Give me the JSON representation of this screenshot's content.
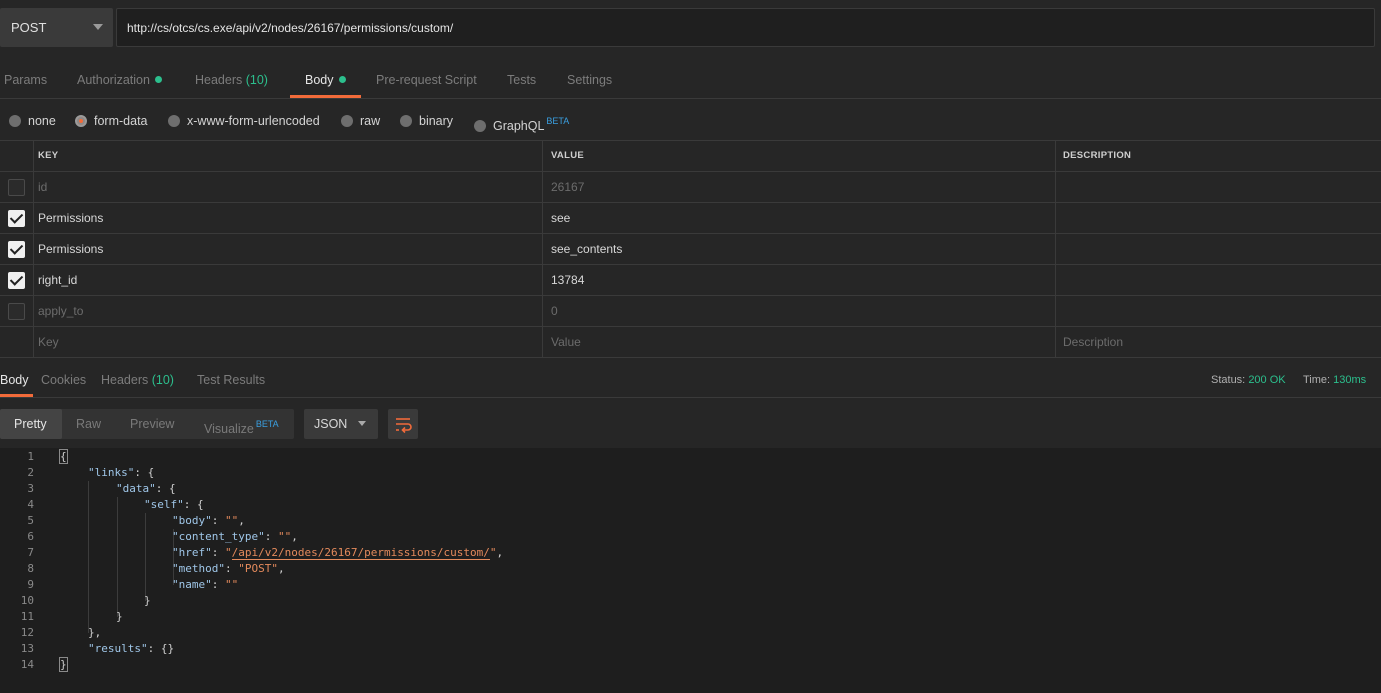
{
  "request": {
    "method": "POST",
    "url": "http://cs/otcs/cs.exe/api/v2/nodes/26167/permissions/custom/"
  },
  "request_tabs": [
    {
      "label": "Params",
      "count": "",
      "dot": false,
      "active": false
    },
    {
      "label": "Authorization",
      "count": "",
      "dot": true,
      "active": false
    },
    {
      "label": "Headers",
      "count": "(10)",
      "dot": false,
      "active": false
    },
    {
      "label": "Body",
      "count": "",
      "dot": true,
      "active": true
    },
    {
      "label": "Pre-request Script",
      "count": "",
      "dot": false,
      "active": false
    },
    {
      "label": "Tests",
      "count": "",
      "dot": false,
      "active": false
    },
    {
      "label": "Settings",
      "count": "",
      "dot": false,
      "active": false
    }
  ],
  "body_types": [
    {
      "label": "none",
      "selected": false
    },
    {
      "label": "form-data",
      "selected": true
    },
    {
      "label": "x-www-form-urlencoded",
      "selected": false
    },
    {
      "label": "raw",
      "selected": false
    },
    {
      "label": "binary",
      "selected": false
    },
    {
      "label": "GraphQL",
      "selected": false,
      "badge": "BETA"
    }
  ],
  "form_table": {
    "headers": {
      "key": "KEY",
      "value": "VALUE",
      "description": "DESCRIPTION"
    },
    "rows": [
      {
        "checked": false,
        "key": "id",
        "value": "26167",
        "description": ""
      },
      {
        "checked": true,
        "key": "Permissions",
        "value": "see",
        "description": ""
      },
      {
        "checked": true,
        "key": "Permissions",
        "value": "see_contents",
        "description": ""
      },
      {
        "checked": true,
        "key": "right_id",
        "value": "13784",
        "description": ""
      },
      {
        "checked": false,
        "key": "apply_to",
        "value": "0",
        "description": ""
      }
    ],
    "placeholder": {
      "key": "Key",
      "value": "Value",
      "description": "Description"
    }
  },
  "response_tabs": [
    {
      "label": "Body",
      "count": "",
      "active": true
    },
    {
      "label": "Cookies",
      "count": "",
      "active": false
    },
    {
      "label": "Headers",
      "count": "(10)",
      "active": false
    },
    {
      "label": "Test Results",
      "count": "",
      "active": false
    }
  ],
  "status": {
    "status_label": "Status:",
    "status_value": "200 OK",
    "time_label": "Time:",
    "time_value": "130ms"
  },
  "view_modes": [
    {
      "label": "Pretty",
      "active": true
    },
    {
      "label": "Raw",
      "active": false
    },
    {
      "label": "Preview",
      "active": false
    },
    {
      "label": "Visualize",
      "active": false,
      "badge": "BETA"
    }
  ],
  "format": "JSON",
  "wrap_icon": "wrap-lines-icon",
  "colors": {
    "accent": "#f26b3a",
    "success": "#2cbf8d",
    "beta": "#3a9fe0"
  },
  "code_lines": [
    {
      "n": "1",
      "indent": 0,
      "parts": [
        [
          "p",
          "{"
        ]
      ]
    },
    {
      "n": "2",
      "indent": 1,
      "parts": [
        [
          "k",
          "\"links\""
        ],
        [
          "p",
          ": {"
        ]
      ]
    },
    {
      "n": "3",
      "indent": 2,
      "parts": [
        [
          "k",
          "\"data\""
        ],
        [
          "p",
          ": {"
        ]
      ]
    },
    {
      "n": "4",
      "indent": 3,
      "parts": [
        [
          "k",
          "\"self\""
        ],
        [
          "p",
          ": {"
        ]
      ]
    },
    {
      "n": "5",
      "indent": 4,
      "parts": [
        [
          "k",
          "\"body\""
        ],
        [
          "p",
          ": "
        ],
        [
          "s",
          "\"\""
        ],
        [
          "p",
          ","
        ]
      ]
    },
    {
      "n": "6",
      "indent": 4,
      "parts": [
        [
          "k",
          "\"content_type\""
        ],
        [
          "p",
          ": "
        ],
        [
          "s",
          "\"\""
        ],
        [
          "p",
          ","
        ]
      ]
    },
    {
      "n": "7",
      "indent": 4,
      "parts": [
        [
          "k",
          "\"href\""
        ],
        [
          "p",
          ": "
        ],
        [
          "s",
          "\""
        ],
        [
          "su",
          "/api/v2/nodes/26167/permissions/custom/"
        ],
        [
          "s",
          "\""
        ],
        [
          "p",
          ","
        ]
      ]
    },
    {
      "n": "8",
      "indent": 4,
      "parts": [
        [
          "k",
          "\"method\""
        ],
        [
          "p",
          ": "
        ],
        [
          "s",
          "\"POST\""
        ],
        [
          "p",
          ","
        ]
      ]
    },
    {
      "n": "9",
      "indent": 4,
      "parts": [
        [
          "k",
          "\"name\""
        ],
        [
          "p",
          ": "
        ],
        [
          "s",
          "\"\""
        ]
      ]
    },
    {
      "n": "10",
      "indent": 3,
      "parts": [
        [
          "p",
          "}"
        ]
      ]
    },
    {
      "n": "11",
      "indent": 2,
      "parts": [
        [
          "p",
          "}"
        ]
      ]
    },
    {
      "n": "12",
      "indent": 1,
      "parts": [
        [
          "p",
          "},"
        ]
      ]
    },
    {
      "n": "13",
      "indent": 1,
      "parts": [
        [
          "k",
          "\"results\""
        ],
        [
          "p",
          ": {}"
        ]
      ]
    },
    {
      "n": "14",
      "indent": 0,
      "parts": [
        [
          "p",
          "}"
        ]
      ]
    }
  ]
}
